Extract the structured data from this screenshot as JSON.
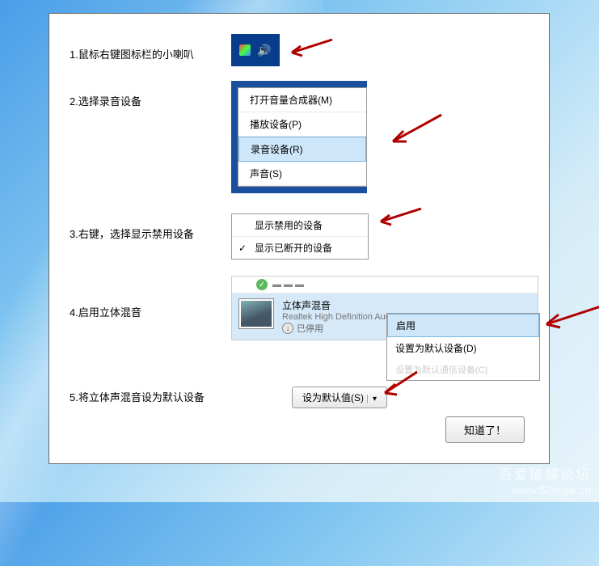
{
  "steps": {
    "s1": {
      "label": "1.鼠标右键图标栏的小喇叭"
    },
    "s2": {
      "label": "2.选择录音设备",
      "menu": [
        "打开音量合成器(M)",
        "播放设备(P)",
        "录音设备(R)",
        "声音(S)"
      ]
    },
    "s3": {
      "label": "3.右键，选择显示禁用设备",
      "items": [
        "显示禁用的设备",
        "显示已断开的设备"
      ]
    },
    "s4": {
      "label": "4.启用立体混音",
      "device": {
        "title": "立体声混音",
        "sub": "Realtek High Definition Audio",
        "status": "已停用"
      },
      "submenu": [
        "启用",
        "设置为默认设备(D)",
        "设置为默认通信设备(C)"
      ]
    },
    "s5": {
      "label": "5.将立体声混音设为默认设备",
      "button": "设为默认值(S)"
    }
  },
  "confirm": "知道了！",
  "watermark": {
    "cn": "吾爱破解论坛",
    "url": "www.52pojie.cn"
  },
  "colors": {
    "arrow": "#b00000",
    "highlight": "#cde6f9",
    "tray": "#083d8c"
  }
}
